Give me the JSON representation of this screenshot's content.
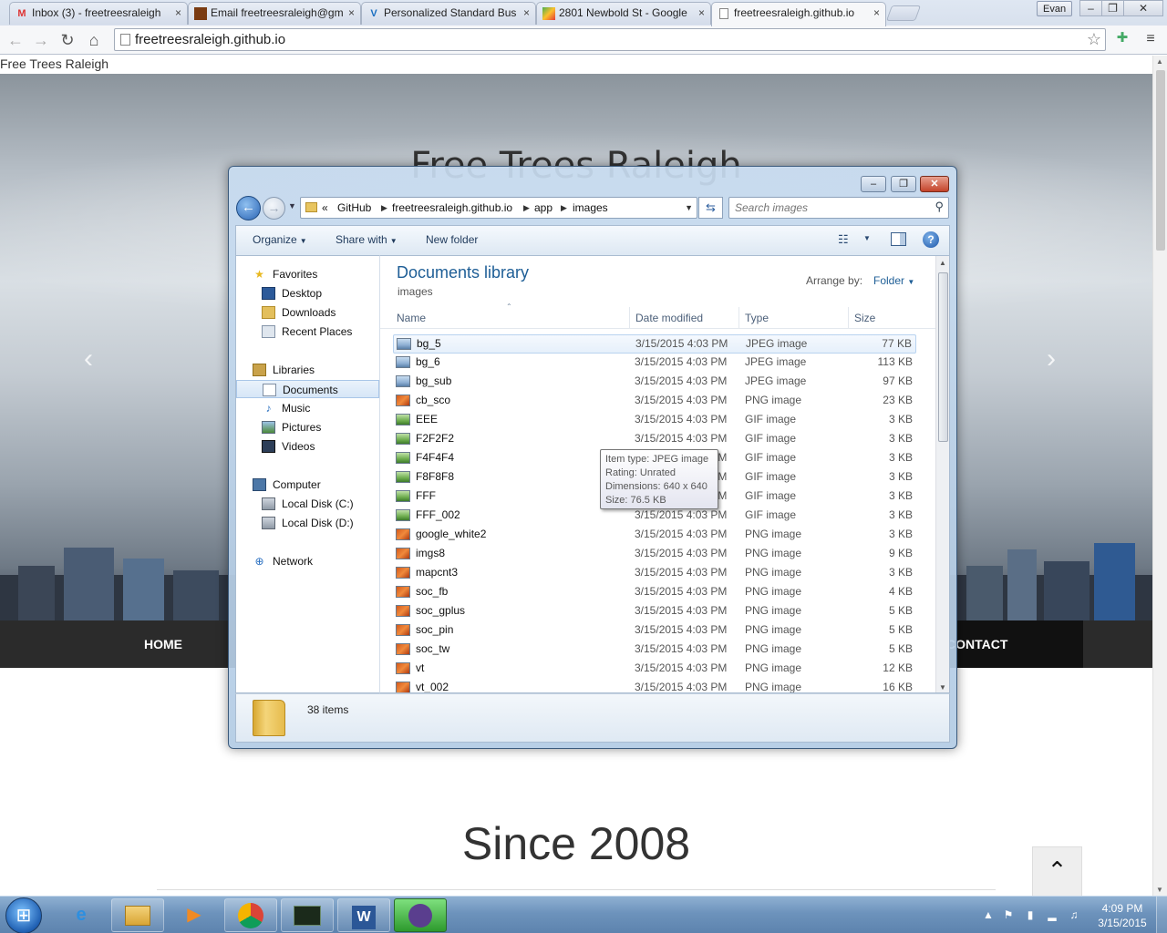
{
  "browser": {
    "tabs": [
      {
        "label": "Inbox (3) - freetreesraleigh",
        "icon": "gmail-icon"
      },
      {
        "label": "Email freetreesraleigh@gm",
        "icon": "email-icon"
      },
      {
        "label": "Personalized Standard Bus",
        "icon": "vistaprint-icon"
      },
      {
        "label": "2801 Newbold St - Google",
        "icon": "maps-icon"
      },
      {
        "label": "freetreesraleigh.github.io",
        "icon": "page-icon"
      }
    ],
    "tab_close_glyph": "×",
    "profile": "Evan",
    "window_controls": {
      "minimize": "–",
      "maximize": "❐",
      "close": "✕"
    },
    "url": "freetreesraleigh.github.io"
  },
  "page": {
    "doc_title": "Free Trees Raleigh",
    "hero_title": "Free Trees Raleigh",
    "nav": {
      "home": "HOME",
      "contact": "CONTACT"
    },
    "since": "Since 2008",
    "back_to_top": "⌃"
  },
  "explorer": {
    "address": {
      "overflow": "«",
      "crumbs": [
        "GitHub",
        "freetreesraleigh.github.io",
        "app",
        "images"
      ],
      "sep": "▶"
    },
    "search_placeholder": "Search images",
    "commands": {
      "organize": "Organize",
      "share_with": "Share with",
      "new_folder": "New folder"
    },
    "nav": {
      "favorites": "Favorites",
      "desktop": "Desktop",
      "downloads": "Downloads",
      "recent_places": "Recent Places",
      "libraries": "Libraries",
      "documents": "Documents",
      "music": "Music",
      "pictures": "Pictures",
      "videos": "Videos",
      "computer": "Computer",
      "local_disk_c": "Local Disk (C:)",
      "local_disk_d": "Local Disk (D:)",
      "network": "Network"
    },
    "library_title": "Documents library",
    "library_sub": "images",
    "arrange_label": "Arrange by:",
    "arrange_value": "Folder",
    "columns": {
      "name": "Name",
      "date": "Date modified",
      "type": "Type",
      "size": "Size"
    },
    "files": [
      {
        "name": "bg_5",
        "date": "3/15/2015 4:03 PM",
        "type": "JPEG image",
        "size": "77 KB",
        "kind": "jpeg"
      },
      {
        "name": "bg_6",
        "date": "3/15/2015 4:03 PM",
        "type": "JPEG image",
        "size": "113 KB",
        "kind": "jpeg"
      },
      {
        "name": "bg_sub",
        "date": "3/15/2015 4:03 PM",
        "type": "JPEG image",
        "size": "97 KB",
        "kind": "jpeg"
      },
      {
        "name": "cb_sco",
        "date": "3/15/2015 4:03 PM",
        "type": "PNG image",
        "size": "23 KB",
        "kind": "png"
      },
      {
        "name": "EEE",
        "date": "3/15/2015 4:03 PM",
        "type": "GIF image",
        "size": "3 KB",
        "kind": "gif"
      },
      {
        "name": "F2F2F2",
        "date": "3/15/2015 4:03 PM",
        "type": "GIF image",
        "size": "3 KB",
        "kind": "gif"
      },
      {
        "name": "F4F4F4",
        "date": "3/15/2015 4:03 PM",
        "type": "GIF image",
        "size": "3 KB",
        "kind": "gif"
      },
      {
        "name": "F8F8F8",
        "date": "3/15/2015 4:03 PM",
        "type": "GIF image",
        "size": "3 KB",
        "kind": "gif"
      },
      {
        "name": "FFF",
        "date": "3/15/2015 4:03 PM",
        "type": "GIF image",
        "size": "3 KB",
        "kind": "gif"
      },
      {
        "name": "FFF_002",
        "date": "3/15/2015 4:03 PM",
        "type": "GIF image",
        "size": "3 KB",
        "kind": "gif"
      },
      {
        "name": "google_white2",
        "date": "3/15/2015 4:03 PM",
        "type": "PNG image",
        "size": "3 KB",
        "kind": "png"
      },
      {
        "name": "imgs8",
        "date": "3/15/2015 4:03 PM",
        "type": "PNG image",
        "size": "9 KB",
        "kind": "png"
      },
      {
        "name": "mapcnt3",
        "date": "3/15/2015 4:03 PM",
        "type": "PNG image",
        "size": "3 KB",
        "kind": "png"
      },
      {
        "name": "soc_fb",
        "date": "3/15/2015 4:03 PM",
        "type": "PNG image",
        "size": "4 KB",
        "kind": "png"
      },
      {
        "name": "soc_gplus",
        "date": "3/15/2015 4:03 PM",
        "type": "PNG image",
        "size": "5 KB",
        "kind": "png"
      },
      {
        "name": "soc_pin",
        "date": "3/15/2015 4:03 PM",
        "type": "PNG image",
        "size": "5 KB",
        "kind": "png"
      },
      {
        "name": "soc_tw",
        "date": "3/15/2015 4:03 PM",
        "type": "PNG image",
        "size": "5 KB",
        "kind": "png"
      },
      {
        "name": "vt",
        "date": "3/15/2015 4:03 PM",
        "type": "PNG image",
        "size": "12 KB",
        "kind": "png"
      },
      {
        "name": "vt_002",
        "date": "3/15/2015 4:03 PM",
        "type": "PNG image",
        "size": "16 KB",
        "kind": "png"
      }
    ],
    "tooltip": {
      "item_type": "Item type: JPEG image",
      "rating": "Rating: Unrated",
      "dimensions": "Dimensions: 640 x 640",
      "size": "Size: 76.5 KB"
    },
    "item_count": "38 items"
  },
  "taskbar": {
    "clock_time": "4:09 PM",
    "clock_date": "3/15/2015",
    "icons": [
      "start-icon",
      "ie-icon",
      "explorer-icon",
      "media-player-icon",
      "chrome-icon",
      "cmd-icon",
      "word-icon",
      "github-icon"
    ]
  },
  "colors": {
    "library_title": "#1e5e96",
    "site_nav": "#2b2b2b",
    "taskbar": "#6d93bc"
  }
}
